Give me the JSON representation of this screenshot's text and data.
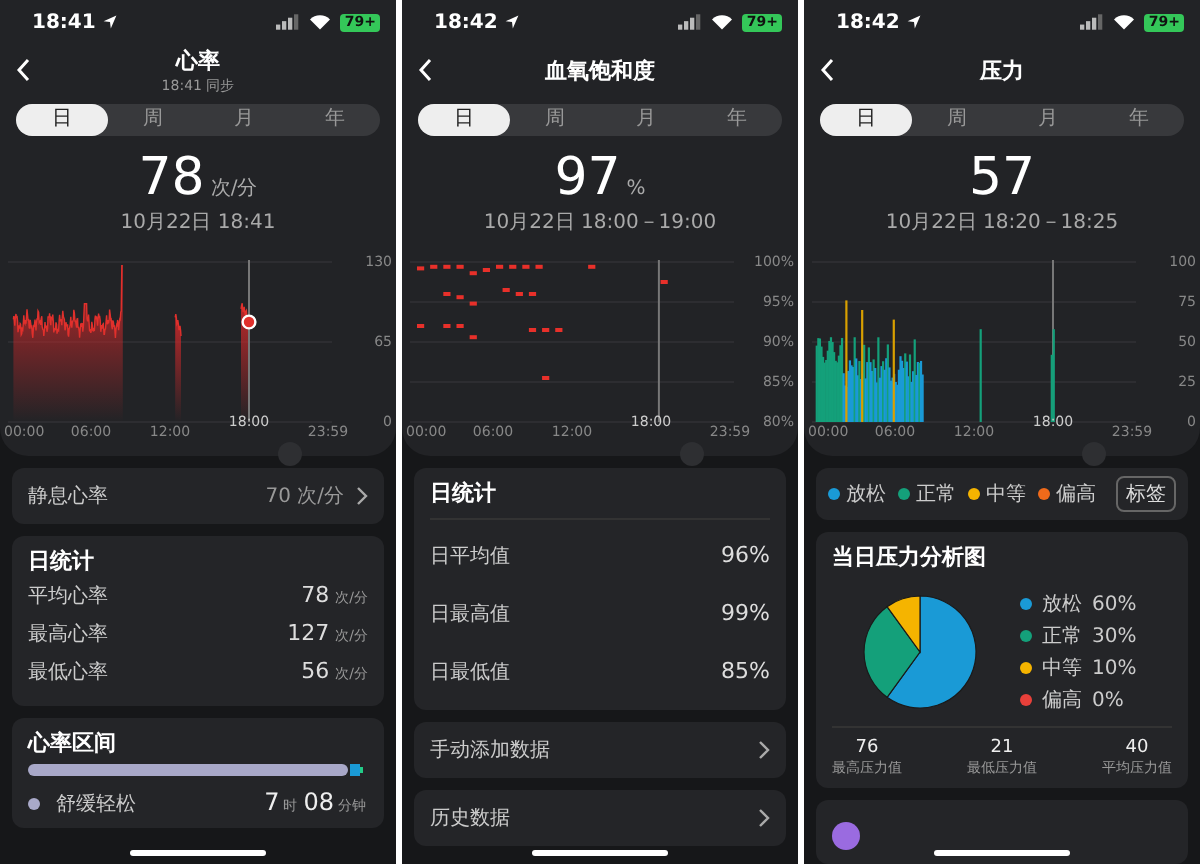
{
  "panels": [
    {
      "kind": "heart",
      "status_time": "18:41",
      "battery": "79+",
      "title": "心率",
      "subtitle": "18:41 同步",
      "tabs": [
        {
          "label": "日",
          "selected": true
        },
        {
          "label": "周",
          "selected": false
        },
        {
          "label": "月",
          "selected": false
        },
        {
          "label": "年",
          "selected": false
        }
      ],
      "value": "78",
      "unit": "次/分",
      "date": "10月22日 18:41",
      "chart": {
        "y_labels": [
          "130",
          "65",
          "0"
        ],
        "x_labels": [
          {
            "label": "00:00",
            "selected": false
          },
          {
            "label": "06:00",
            "selected": false
          },
          {
            "label": "12:00",
            "selected": false
          },
          {
            "label": "18:00",
            "selected": true
          },
          {
            "label": "23:59",
            "selected": false
          }
        ]
      },
      "cards": [
        {
          "kind": "link_row",
          "label": "静息心率",
          "value": "70 次/分"
        },
        {
          "kind": "stats",
          "title": "日统计",
          "rows": [
            {
              "label": "平均心率",
              "value": "78",
              "unit": "次/分"
            },
            {
              "label": "最高心率",
              "value": "127",
              "unit": "次/分"
            },
            {
              "label": "最低心率",
              "value": "56",
              "unit": "次/分"
            }
          ]
        },
        {
          "kind": "zones",
          "title": "心率区间",
          "rows": [
            {
              "label": "舒缓轻松",
              "color": "#a9a9c9",
              "parts": [
                {
                  "num": "7",
                  "unit": "时"
                },
                {
                  "num": "08",
                  "unit": "分钟"
                }
              ]
            }
          ]
        }
      ]
    },
    {
      "kind": "spo2",
      "status_time": "18:42",
      "battery": "79+",
      "title": "血氧饱和度",
      "tabs": [
        {
          "label": "日",
          "selected": true
        },
        {
          "label": "周",
          "selected": false
        },
        {
          "label": "月",
          "selected": false
        },
        {
          "label": "年",
          "selected": false
        }
      ],
      "value": "97",
      "unit": "%",
      "date": "10月22日 18:00－19:00",
      "chart": {
        "y_labels": [
          "100%",
          "95%",
          "90%",
          "85%",
          "80%"
        ],
        "x_labels": [
          {
            "label": "00:00",
            "selected": false
          },
          {
            "label": "06:00",
            "selected": false
          },
          {
            "label": "12:00",
            "selected": false
          },
          {
            "label": "18:00",
            "selected": true
          },
          {
            "label": "23:59",
            "selected": false
          }
        ]
      },
      "cards": [
        {
          "kind": "stats",
          "title": "日统计",
          "rows": [
            {
              "label": "日平均值",
              "value": "96%"
            },
            {
              "label": "日最高值",
              "value": "99%"
            },
            {
              "label": "日最低值",
              "value": "85%"
            }
          ]
        },
        {
          "kind": "link_row",
          "label": "手动添加数据"
        },
        {
          "kind": "link_row",
          "label": "历史数据"
        }
      ]
    },
    {
      "kind": "stress",
      "status_time": "18:42",
      "battery": "79+",
      "title": "压力",
      "tabs": [
        {
          "label": "日",
          "selected": true
        },
        {
          "label": "周",
          "selected": false
        },
        {
          "label": "月",
          "selected": false
        },
        {
          "label": "年",
          "selected": false
        }
      ],
      "value": "57",
      "date": "10月22日 18:20－18:25",
      "chart": {
        "y_labels": [
          "100",
          "75",
          "50",
          "25",
          "0"
        ],
        "x_labels": [
          {
            "label": "00:00",
            "selected": false
          },
          {
            "label": "06:00",
            "selected": false
          },
          {
            "label": "12:00",
            "selected": false
          },
          {
            "label": "18:00",
            "selected": true
          },
          {
            "label": "23:59",
            "selected": false
          }
        ]
      },
      "cards": [
        {
          "kind": "legend",
          "items": [
            {
              "label": "放松",
              "color": "#1a9ad6"
            },
            {
              "label": "正常",
              "color": "#14a07a"
            },
            {
              "label": "中等",
              "color": "#f5b400"
            },
            {
              "label": "偏高",
              "color": "#f06a1a"
            }
          ],
          "button": "标签"
        },
        {
          "kind": "analysis",
          "title": "当日压力分析图",
          "legend": [
            {
              "share": "60%",
              "color": "#1a9ad6"
            },
            {
              "share": "30%",
              "color": "#14a07a"
            },
            {
              "share": "10%",
              "color": "#f5b400"
            },
            {
              "share": "0%",
              "color": "#e8403a"
            }
          ],
          "chart_data": {
            "type": "pie",
            "categories": [
              "放松",
              "正常",
              "中等",
              "偏高"
            ],
            "values": [
              60,
              30,
              10,
              0
            ]
          },
          "stats": [
            {
              "value": "76",
              "label": "最高压力值"
            },
            {
              "value": "21",
              "label": "最低压力值"
            },
            {
              "value": "40",
              "label": "平均压力值"
            }
          ]
        },
        {
          "kind": "avatar_row"
        }
      ]
    }
  ]
}
